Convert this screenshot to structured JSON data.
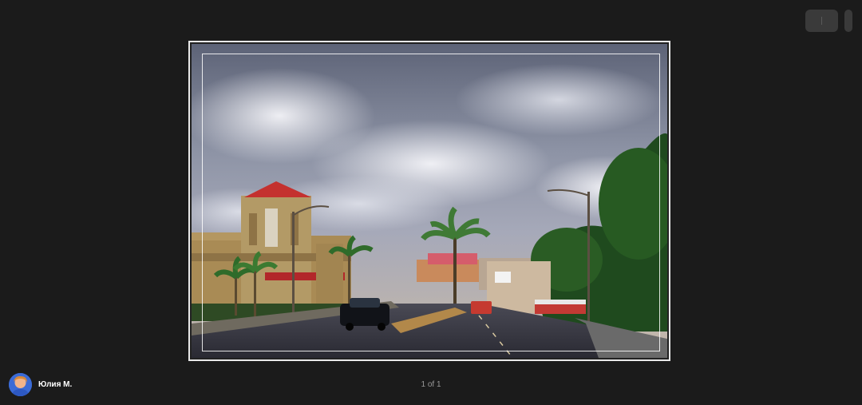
{
  "author": {
    "name": "Юлия М."
  },
  "pager": {
    "text": "1 of 1"
  },
  "colors": {
    "background": "#1b1b1b",
    "frame": "#e9e9e9",
    "control": "#3a3a3a",
    "counter_text": "#9a9a9a"
  },
  "icons": {
    "top_control_primary": "menu-icon",
    "top_control_secondary": "more-icon"
  }
}
